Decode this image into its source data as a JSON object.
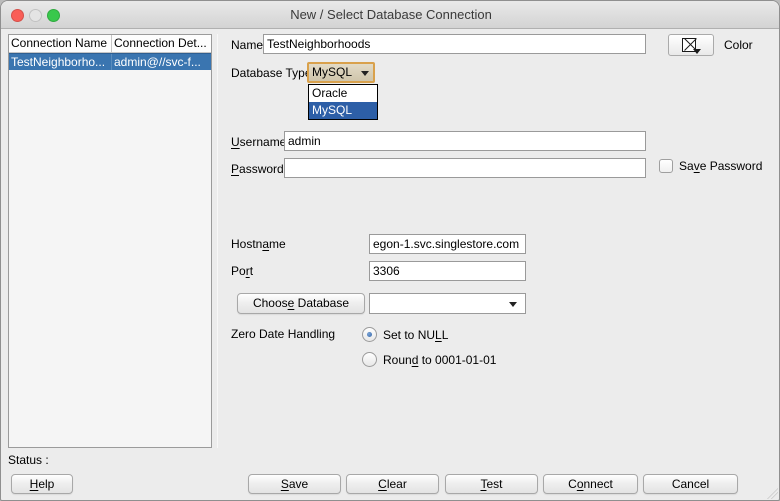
{
  "titlebar": {
    "title": "New / Select Database Connection",
    "traffic_light_colors": {
      "close": "#f95e57",
      "minimize": "#e4e4e4",
      "zoom": "#39c84c"
    }
  },
  "colors": {
    "row_selection_blue": "#3a75b0",
    "popup_selection_blue": "#2d5fa7",
    "focus_ring_orange": "#d9a14c"
  },
  "connections": {
    "columns": [
      "Connection Name",
      "Connection Det..."
    ],
    "selected_row": {
      "name": "TestNeighborho...",
      "details": "admin@//svc-f..."
    }
  },
  "form": {
    "name_label": "Name",
    "name_value": "TestNeighborhoods",
    "color_label": "Color",
    "db_type_label": "Database Type",
    "db_type_value": "MySQL",
    "db_options": [
      "Oracle",
      "MySQL"
    ],
    "username_label": {
      "pre": "",
      "u": "U",
      "post": "sername"
    },
    "username_value": "admin",
    "password_label": {
      "pre": "",
      "u": "P",
      "post": "assword"
    },
    "password_value": "",
    "save_password_label": {
      "pre": "Sa",
      "u": "v",
      "post": "e Password"
    },
    "hostname_label": {
      "pre": "Hostn",
      "u": "a",
      "post": "me"
    },
    "hostname_value": "egon-1.svc.singlestore.com",
    "port_label": {
      "pre": "Po",
      "u": "r",
      "post": "t"
    },
    "port_value": "3306",
    "choose_db_label": {
      "pre": "Choos",
      "u": "e",
      "post": " Database"
    },
    "choose_db_value": "",
    "zero_date_label": "Zero Date Handling",
    "radio_set_null": {
      "pre": "Set to NU",
      "u": "L",
      "post": "L"
    },
    "radio_round": {
      "pre": "Roun",
      "u": "d",
      "post": " to 0001-01-01"
    }
  },
  "status_label": "Status :",
  "buttons": {
    "help": {
      "pre": "",
      "u": "H",
      "post": "elp"
    },
    "save": {
      "pre": "",
      "u": "S",
      "post": "ave"
    },
    "clear": {
      "pre": "",
      "u": "C",
      "post": "lear"
    },
    "test": {
      "pre": "",
      "u": "T",
      "post": "est"
    },
    "connect": {
      "pre": "C",
      "u": "o",
      "post": "nnect"
    },
    "cancel": {
      "pre": "Cancel",
      "u": "",
      "post": ""
    }
  }
}
